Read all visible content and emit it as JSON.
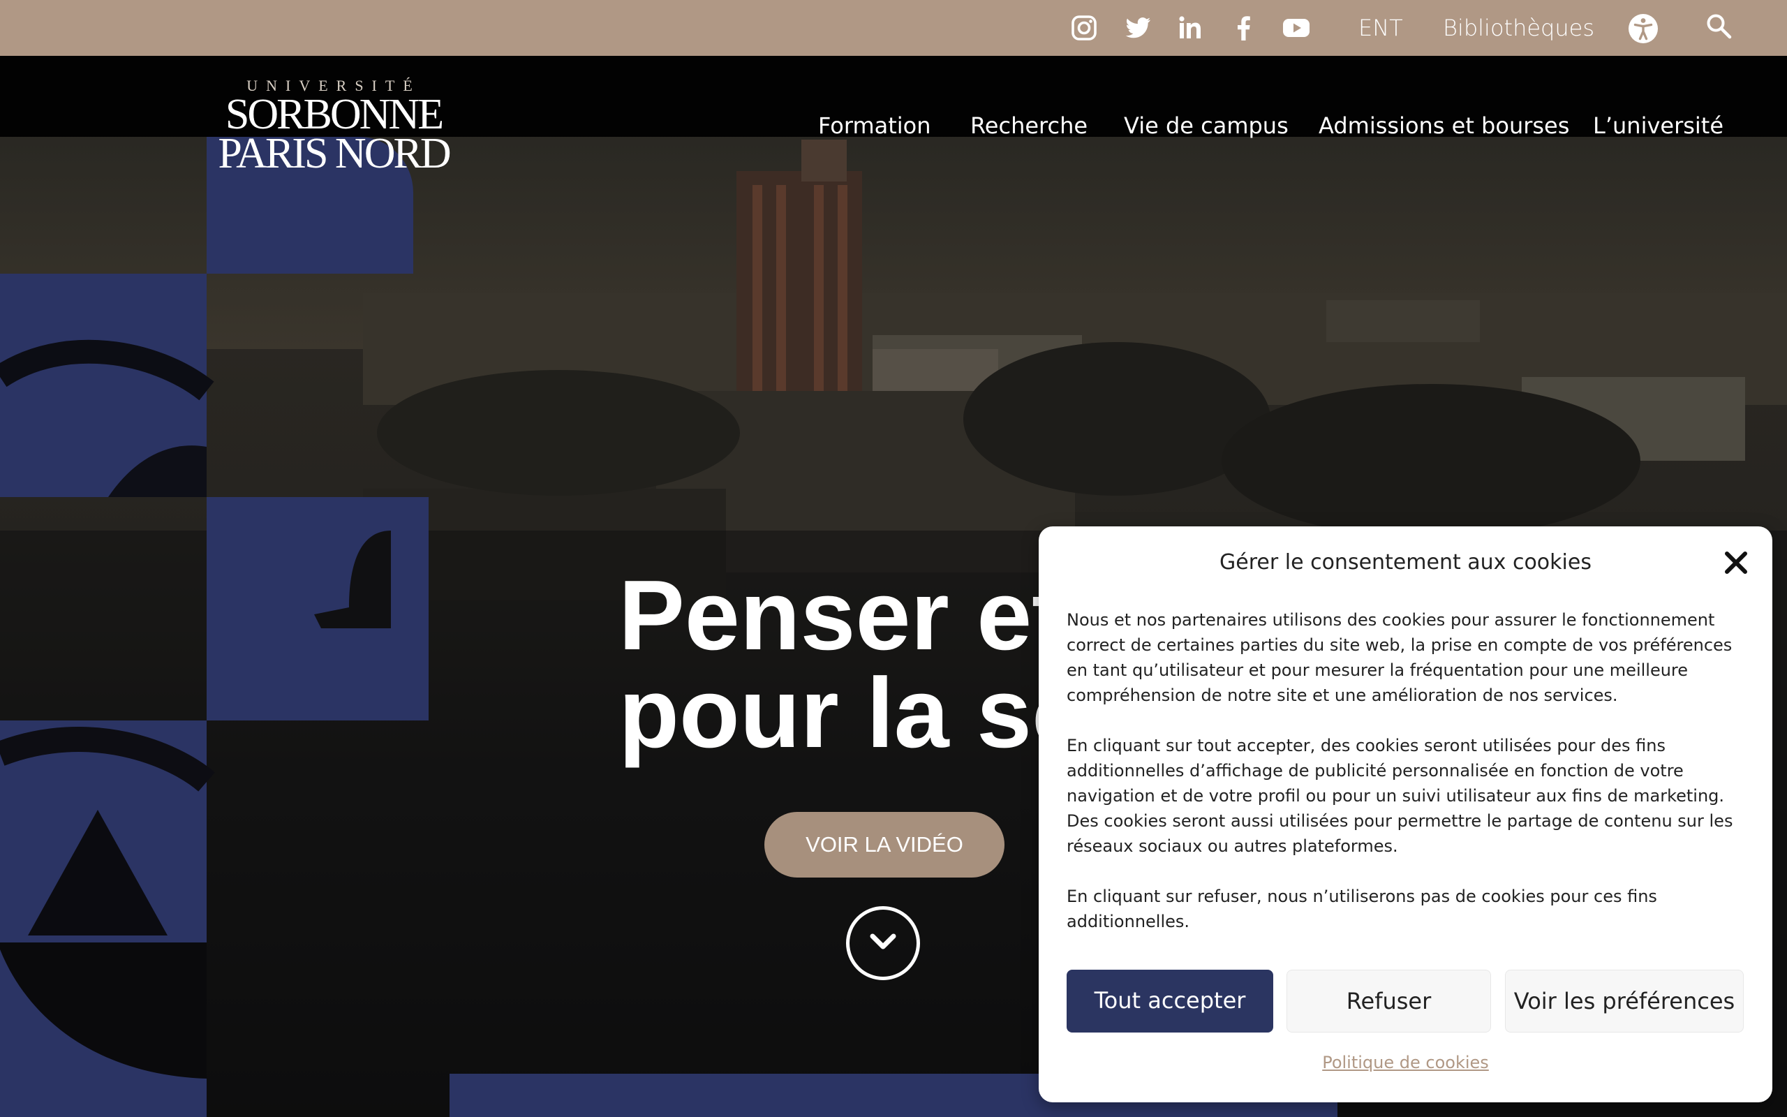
{
  "topbar": {
    "social_icons": [
      "instagram-icon",
      "twitter-icon",
      "linkedin-icon",
      "facebook-icon",
      "youtube-icon"
    ],
    "links": {
      "ent": "ENT",
      "libraries": "Bibliothèques"
    },
    "accessibility_icon": "accessibility-icon",
    "search_icon": "search-icon",
    "background_color": "#b09885"
  },
  "logo": {
    "line1": "UNIVERSITÉ",
    "line2": "SORBONNE",
    "line3": "PARIS NORD"
  },
  "nav": {
    "items": [
      "Formation",
      "Recherche",
      "Vie de campus",
      "Admissions et bourses",
      "L’université"
    ]
  },
  "hero": {
    "title_line1": "Penser et a",
    "title_line2": "pour la soc",
    "video_button": "VOIR LA VIDÉO",
    "scroll_icon": "chevron-down-icon",
    "button_color": "#a7907d",
    "accent_blue": "#2b3464"
  },
  "cookie": {
    "title": "Gérer le consentement aux cookies",
    "close_icon": "close-icon",
    "paragraphs": [
      "Nous et nos partenaires utilisons des cookies pour assurer le fonctionnement correct de certaines parties du site web, la prise en compte de vos préférences en tant qu’utilisateur et pour mesurer la fréquentation pour une meilleure compréhension de notre site et une amélioration de nos services.",
      "En cliquant sur tout accepter, des cookies seront utilisées pour des fins additionnelles d’affichage de publicité personnalisée en fonction de votre navigation et de votre profil ou pour un suivi utilisateur aux fins de marketing. Des cookies seront aussi utilisées pour permettre le partage de contenu sur les réseaux sociaux ou autres plateformes.",
      "En cliquant sur refuser, nous n’utiliserons pas de cookies pour ces fins additionnelles."
    ],
    "accept_label": "Tout accepter",
    "refuse_label": "Refuser",
    "prefs_label": "Voir les préférences",
    "policy_link": "Politique de cookies",
    "accept_color": "#2b3561"
  }
}
